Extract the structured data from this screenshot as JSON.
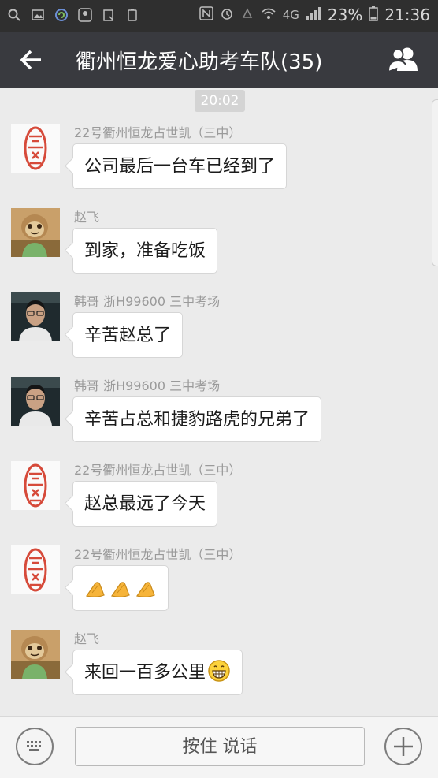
{
  "status_bar": {
    "network": "4G",
    "battery": "23%",
    "time": "21:36"
  },
  "header": {
    "title": "衢州恒龙爱心助考车队(35)",
    "back_icon": "arrow-left-icon",
    "members_icon": "group-members-icon"
  },
  "chat": {
    "timestamp": "20:02",
    "messages": [
      {
        "sender": "22号衢州恒龙占世凯（三中）",
        "text": "公司最后一台车已经到了",
        "avatar": "seal-avatar"
      },
      {
        "sender": "赵飞",
        "text": "到家，准备吃饭",
        "avatar": "sloth-avatar"
      },
      {
        "sender": "韩哥 浙H99600 三中考场",
        "text": "辛苦赵总了",
        "avatar": "man-avatar"
      },
      {
        "sender": "韩哥 浙H99600 三中考场",
        "text": "辛苦占总和捷豹路虎的兄弟了",
        "avatar": "man-avatar"
      },
      {
        "sender": "22号衢州恒龙占世凯（三中）",
        "text": "赵总最远了今天",
        "avatar": "seal-avatar"
      },
      {
        "sender": "22号衢州恒龙占世凯（三中）",
        "text": "",
        "emoji": [
          "praying-hands-emoji",
          "praying-hands-emoji",
          "praying-hands-emoji"
        ],
        "avatar": "seal-avatar"
      },
      {
        "sender": "赵飞",
        "text": "来回一百多公里",
        "emoji": [
          "grinning-face-emoji"
        ],
        "avatar": "sloth-avatar"
      }
    ]
  },
  "input_bar": {
    "voice_label": "按住 说话",
    "keyboard_icon": "keyboard-icon",
    "plus_icon": "plus-icon"
  },
  "colors": {
    "header_bg": "#393a3f",
    "status_bg": "#2f2f2f",
    "chat_bg": "#ebebeb",
    "bubble_bg": "#ffffff"
  }
}
